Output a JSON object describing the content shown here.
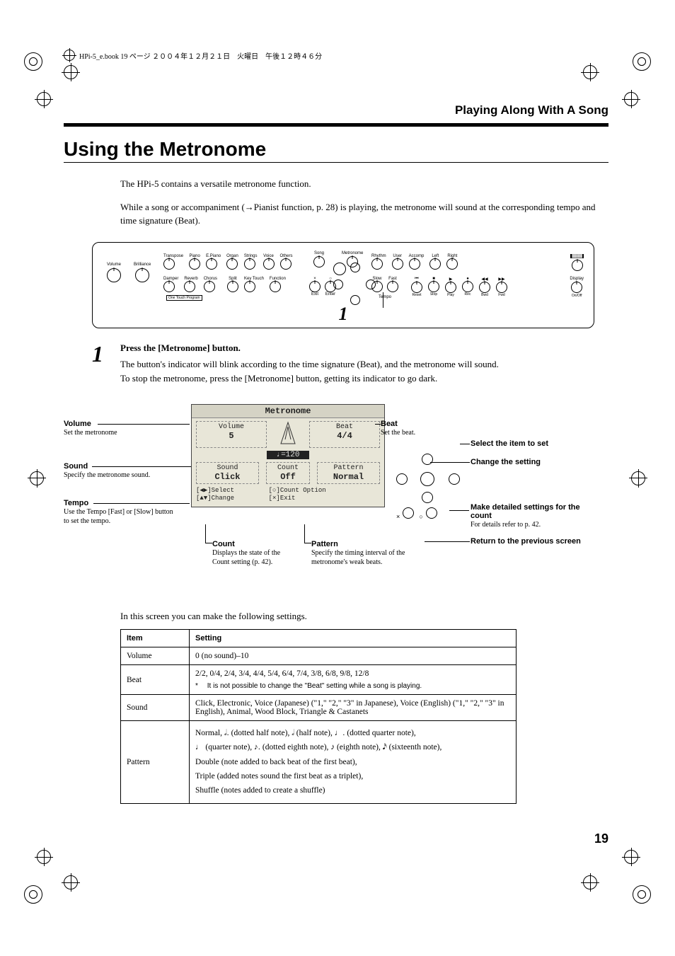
{
  "headerLine": "HPi-5_e.book 19 ページ ２００４年１２月２１日　火曜日　午後１２時４６分",
  "sectionHeader": "Playing Along With A Song",
  "title": "Using the Metronome",
  "intro": {
    "p1": "The HPi-5 contains a versatile metronome function.",
    "p2": "While a song or accompaniment (→Pianist function, p. 28) is playing, the metronome will sound at the corresponding tempo and time signature (Beat)."
  },
  "panel": {
    "marker": "1",
    "labels": {
      "volume": "Volume",
      "brilliance": "Brilliance",
      "transpose": "Transpose",
      "piano": "Piano",
      "epiano": "E.Piano",
      "organ": "Organ",
      "strings": "Strings",
      "voice": "Voice",
      "others": "Others",
      "damper": "Damper",
      "reverb": "Reverb",
      "chorus": "Chorus",
      "split": "Split",
      "keytouch": "Key Touch",
      "function": "Function",
      "song": "Song",
      "metronome": "Metronome",
      "exit": "Exit",
      "enter": "Enter",
      "slow": "Slow",
      "fast": "Fast",
      "tempo": "Tempo",
      "rhythm": "Rhythm",
      "user": "User",
      "accomp": "Accomp",
      "left": "Left",
      "right": "Right",
      "track": "Track",
      "reset": "Reset",
      "stop": "Stop",
      "play": "Play",
      "rec": "Rec",
      "bwd": "Bwd",
      "fwd": "Fwd",
      "display": "Display",
      "onoff": "On/Off",
      "onetouch": "One Touch Program"
    }
  },
  "step1": {
    "num": "1",
    "title": "Press the [Metronome] button.",
    "p1": "The button's indicator will blink according to the time signature (Beat), and the metronome will sound.",
    "p2": "To stop the metronome, press the [Metronome] button, getting its indicator to go dark."
  },
  "lcd": {
    "title": "Metronome",
    "volume": {
      "label": "Volume",
      "value": "5"
    },
    "beat": {
      "label": "Beat",
      "value": "4/4"
    },
    "tempo": "♩=120",
    "sound": {
      "label": "Sound",
      "value": "Click"
    },
    "pattern": {
      "label": "Pattern",
      "value": "Normal"
    },
    "count": {
      "label": "Count",
      "value": "Off"
    },
    "legend1": "[◀▶]Select",
    "legend2": "[▲▼]Change",
    "legend3": "[○]Count Option",
    "legend4": "[×]Exit"
  },
  "callouts": {
    "volume": {
      "title": "Volume",
      "desc": "Set the metronome"
    },
    "sound": {
      "title": "Sound",
      "desc": "Specify the metronome sound."
    },
    "tempo": {
      "title": "Tempo",
      "desc": "Use the Tempo [Fast] or [Slow] button to set the tempo."
    },
    "beat": {
      "title": "Beat",
      "desc": "Set the beat."
    },
    "selectItem": {
      "title": "Select the item to set"
    },
    "changeSetting": {
      "title": "Change the setting"
    },
    "countOption": {
      "title": "Make detailed settings for the count",
      "desc": "For details refer to p. 42."
    },
    "return": {
      "title": "Return to the previous screen"
    },
    "count": {
      "title": "Count",
      "desc": "Displays the state of the Count setting (p. 42)."
    },
    "pattern": {
      "title": "Pattern",
      "desc": "Specify the timing interval of the metronome's weak beats."
    }
  },
  "settingsIntro": "In this screen you can make the following settings.",
  "table": {
    "headers": {
      "item": "Item",
      "setting": "Setting"
    },
    "rows": {
      "volume": {
        "item": "Volume",
        "setting": "0 (no sound)–10"
      },
      "beat": {
        "item": "Beat",
        "line1": "2/2, 0/4, 2/4, 3/4, 4/4, 5/4, 6/4, 7/4, 3/8, 6/8, 9/8, 12/8",
        "note": "It is not possible to change the \"Beat\" setting while a song is playing."
      },
      "sound": {
        "item": "Sound",
        "setting": "Click, Electronic, Voice (Japanese) (\"1,\" \"2,\" \"3\" in Japanese), Voice (English) (\"1,\" \"2,\" \"3\" in English), Animal, Wood Block, Triangle & Castanets"
      },
      "pattern": {
        "item": "Pattern",
        "line1a": "Normal,   ",
        "g1": "𝅗𝅥.",
        "t1": "  (dotted half note),   ",
        "g2": "𝅗𝅥",
        "t2": "  (half note),   ",
        "g3": "♩.",
        "t3": "  (dotted quarter note),",
        "g4": "♩",
        "t4": "  (quarter note),   ",
        "g5": "♪.",
        "t5": "  (dotted eighth note),   ",
        "g6": "♪",
        "t6": "  (eighth note),   ",
        "g7": "𝅘𝅥𝅯",
        "t7": "  (sixteenth note),",
        "line3": "Double (note added to back beat of the first beat),",
        "line4": "Triple (added notes sound the first beat as a triplet),",
        "line5": "Shuffle (notes added to create a shuffle)"
      }
    }
  },
  "pageNumber": "19"
}
